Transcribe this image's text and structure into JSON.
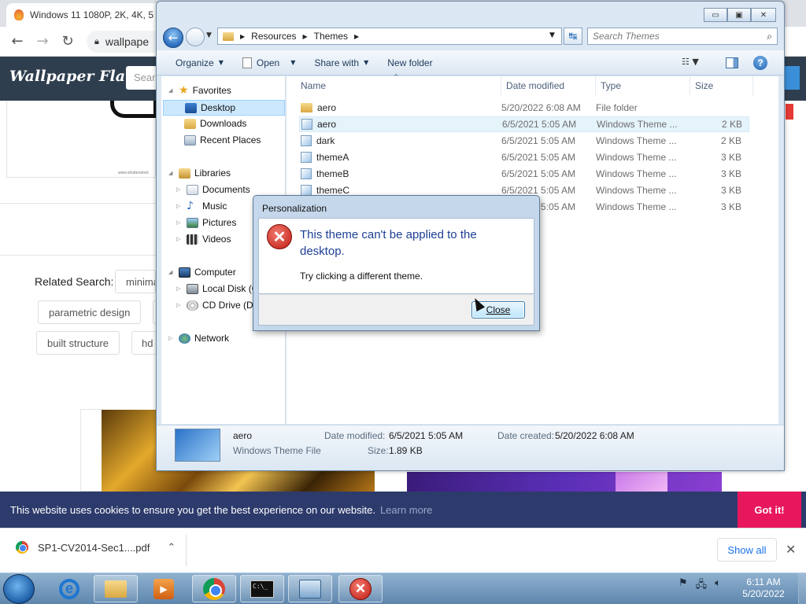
{
  "browser": {
    "tab_title": "Windows 11 1080P, 2K, 4K, 5",
    "url": "wallpape",
    "back_glyph": "←",
    "forward_glyph": "→",
    "reload_glyph": "↻"
  },
  "site": {
    "logo": "Wallpaper Flare",
    "search_placeholder": "Sear",
    "related_label": "Related Search:",
    "tags": [
      "minima",
      "parametric design",
      "built structure",
      "hd"
    ],
    "ad_tiny_text": "www.shutterstock"
  },
  "cookie": {
    "message": "This website uses cookies to ensure you get the best experience on our website.",
    "learn_more": "Learn more",
    "button": "Got it!"
  },
  "downloads": {
    "file": "SP1-CV2014-Sec1....pdf",
    "chevron": "⌃",
    "show_all": "Show all",
    "close_glyph": "✕"
  },
  "explorer": {
    "caption_min": "▭",
    "caption_max": "▣",
    "caption_close": "✕",
    "back_glyph": "←",
    "breadcrumb": [
      "Resources",
      "Themes"
    ],
    "search_placeholder": "Search Themes",
    "search_glyph": "⌕",
    "refresh_glyph": "↹",
    "toolbar": {
      "organize": "Organize",
      "open": "Open",
      "share_with": "Share with",
      "new_folder": "New folder",
      "help": "?"
    },
    "nav": {
      "favorites": "Favorites",
      "desktop": "Desktop",
      "downloads": "Downloads",
      "recent_places": "Recent Places",
      "libraries": "Libraries",
      "documents": "Documents",
      "music": "Music",
      "pictures": "Pictures",
      "videos": "Videos",
      "computer": "Computer",
      "local_disk": "Local Disk (C",
      "cd_drive": "CD Drive (D:",
      "network": "Network"
    },
    "columns": {
      "name": "Name",
      "date_modified": "Date modified",
      "type": "Type",
      "size": "Size"
    },
    "files": [
      {
        "name": "aero",
        "date": "5/20/2022 6:08 AM",
        "type": "File folder",
        "size": ""
      },
      {
        "name": "aero",
        "date": "6/5/2021 5:05 AM",
        "type": "Windows Theme ...",
        "size": "2 KB"
      },
      {
        "name": "dark",
        "date": "6/5/2021 5:05 AM",
        "type": "Windows Theme ...",
        "size": "2 KB"
      },
      {
        "name": "themeA",
        "date": "6/5/2021 5:05 AM",
        "type": "Windows Theme ...",
        "size": "3 KB"
      },
      {
        "name": "themeB",
        "date": "6/5/2021 5:05 AM",
        "type": "Windows Theme ...",
        "size": "3 KB"
      },
      {
        "name": "themeC",
        "date": "6/5/2021 5:05 AM",
        "type": "Windows Theme ...",
        "size": "3 KB"
      },
      {
        "name": "",
        "date": "6/5/2021 5:05 AM",
        "type": "Windows Theme ...",
        "size": "3 KB"
      }
    ],
    "details": {
      "name": "aero",
      "type": "Windows Theme File",
      "modified_label": "Date modified:",
      "modified": "6/5/2021 5:05 AM",
      "size_label": "Size:",
      "size": "1.89 KB",
      "created_label": "Date created:",
      "created": "5/20/2022 6:08 AM"
    }
  },
  "dialog": {
    "title": "Personalization",
    "message": "This theme can't be applied to the desktop.",
    "hint": "Try clicking a different theme.",
    "close_button": "Close",
    "icon_glyph": "✕"
  },
  "taskbar": {
    "time": "6:11 AM",
    "date": "5/20/2022",
    "ie_glyph": "e",
    "media_glyph": "▶",
    "cmd_text": "C:\\_",
    "error_glyph": "✕"
  },
  "colors": {
    "site_header": "#2f3e4e",
    "cookie_bar": "#2d3b6c",
    "cookie_button": "#e8175d",
    "dialog_text": "#1c3f94"
  }
}
